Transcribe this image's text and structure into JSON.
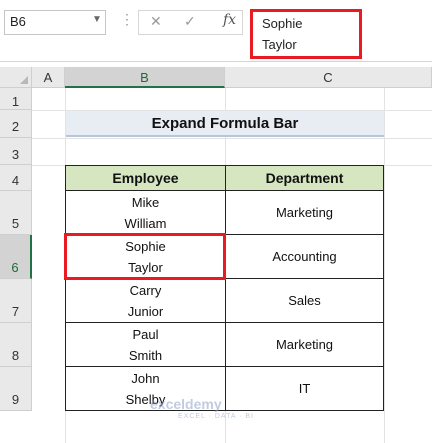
{
  "formula_bar": {
    "name_box": "B6",
    "fx": "fx",
    "cancel": "✕",
    "enter": "✓",
    "content_lines": [
      "Sophie",
      "Taylor"
    ]
  },
  "columns": [
    "A",
    "B",
    "C"
  ],
  "rows": [
    "1",
    "2",
    "3",
    "4",
    "5",
    "6",
    "7",
    "8",
    "9"
  ],
  "sheet": {
    "title": "Expand Formula Bar",
    "headers": [
      "Employee",
      "Department"
    ],
    "records": [
      {
        "employee": [
          "Mike",
          "William"
        ],
        "department": "Marketing"
      },
      {
        "employee": [
          "Sophie",
          "Taylor"
        ],
        "department": "Accounting"
      },
      {
        "employee": [
          "Carry",
          "Junior"
        ],
        "department": "Sales"
      },
      {
        "employee": [
          "Paul",
          "Smith"
        ],
        "department": "Marketing"
      },
      {
        "employee": [
          "John",
          "Shelby"
        ],
        "department": "IT"
      }
    ]
  },
  "watermark": {
    "name": "exceldemy",
    "tagline": "EXCEL · DATA · BI"
  },
  "colors": {
    "highlight": "#e81b23",
    "header_fill": "#d5e6c1",
    "title_fill": "#e8edf3",
    "excel_green": "#217346"
  }
}
